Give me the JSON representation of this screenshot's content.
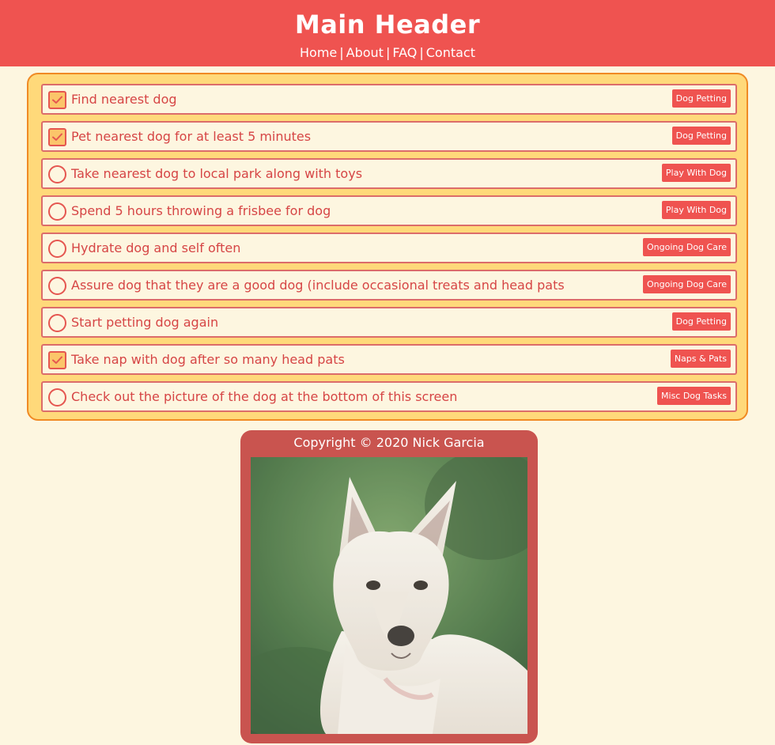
{
  "header": {
    "title": "Main Header",
    "nav": [
      "Home",
      "About",
      "FAQ",
      "Contact"
    ],
    "separator": "|"
  },
  "todos": [
    {
      "text": "Find nearest dog",
      "tag": "Dog Petting",
      "done": true
    },
    {
      "text": "Pet nearest dog for at least 5 minutes",
      "tag": "Dog Petting",
      "done": true
    },
    {
      "text": "Take nearest dog to local park along with toys",
      "tag": "Play With Dog",
      "done": false
    },
    {
      "text": "Spend 5 hours throwing a frisbee for dog",
      "tag": "Play With Dog",
      "done": false
    },
    {
      "text": "Hydrate dog and self often",
      "tag": "Ongoing Dog Care",
      "done": false
    },
    {
      "text": "Assure dog that they are a good dog (include occasional treats and head pats",
      "tag": "Ongoing Dog Care",
      "done": false
    },
    {
      "text": "Start petting dog again",
      "tag": "Dog Petting",
      "done": false
    },
    {
      "text": "Take nap with dog after so many head pats",
      "tag": "Naps & Pats",
      "done": true
    },
    {
      "text": "Check out the picture of the dog at the bottom of this screen",
      "tag": "Misc Dog Tasks",
      "done": false
    }
  ],
  "footer": {
    "copyright": "Copyright © 2020 Nick Garcia"
  },
  "colors": {
    "header_bg": "#ef5350",
    "page_bg": "#fdf6e0",
    "panel_bg": "#ffd97a",
    "panel_border": "#f08a24",
    "item_border": "#dc6c6a",
    "text": "#d64545",
    "tag_bg": "#ef5350",
    "footer_bg": "#c9544f"
  }
}
